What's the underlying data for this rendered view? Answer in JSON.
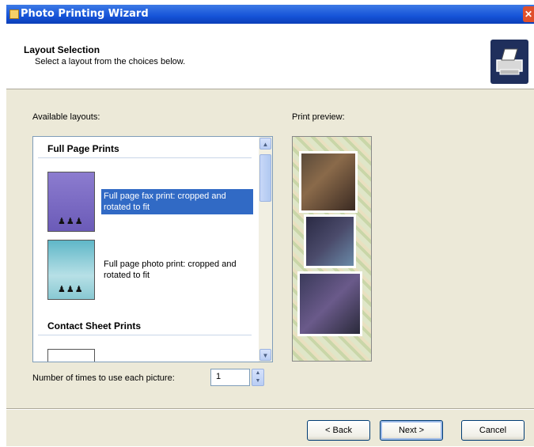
{
  "window": {
    "title": "Photo Printing Wizard",
    "close_glyph": "✕"
  },
  "header": {
    "title": "Layout Selection",
    "subtitle": "Select a layout from the choices below.",
    "icon": "printer-icon"
  },
  "layouts": {
    "label": "Available layouts:",
    "groups": [
      {
        "title": "Full Page Prints"
      },
      {
        "title": "Contact Sheet Prints"
      }
    ],
    "items": [
      {
        "text": "Full page fax print: cropped and rotated to fit",
        "selected": true,
        "thumb_glyph": "♟♟♟"
      },
      {
        "text": "Full page photo print: cropped and rotated to fit",
        "selected": false,
        "thumb_glyph": "♟♟♟"
      }
    ],
    "scroll_up": "▲",
    "scroll_down": "▼"
  },
  "preview": {
    "label": "Print preview:"
  },
  "copies": {
    "label": "Number of times to use each picture:",
    "value": "1",
    "spin_up": "▲",
    "spin_down": "▼"
  },
  "footer": {
    "back_label": "< Back",
    "next_label": "Next >",
    "cancel_label": "Cancel"
  }
}
